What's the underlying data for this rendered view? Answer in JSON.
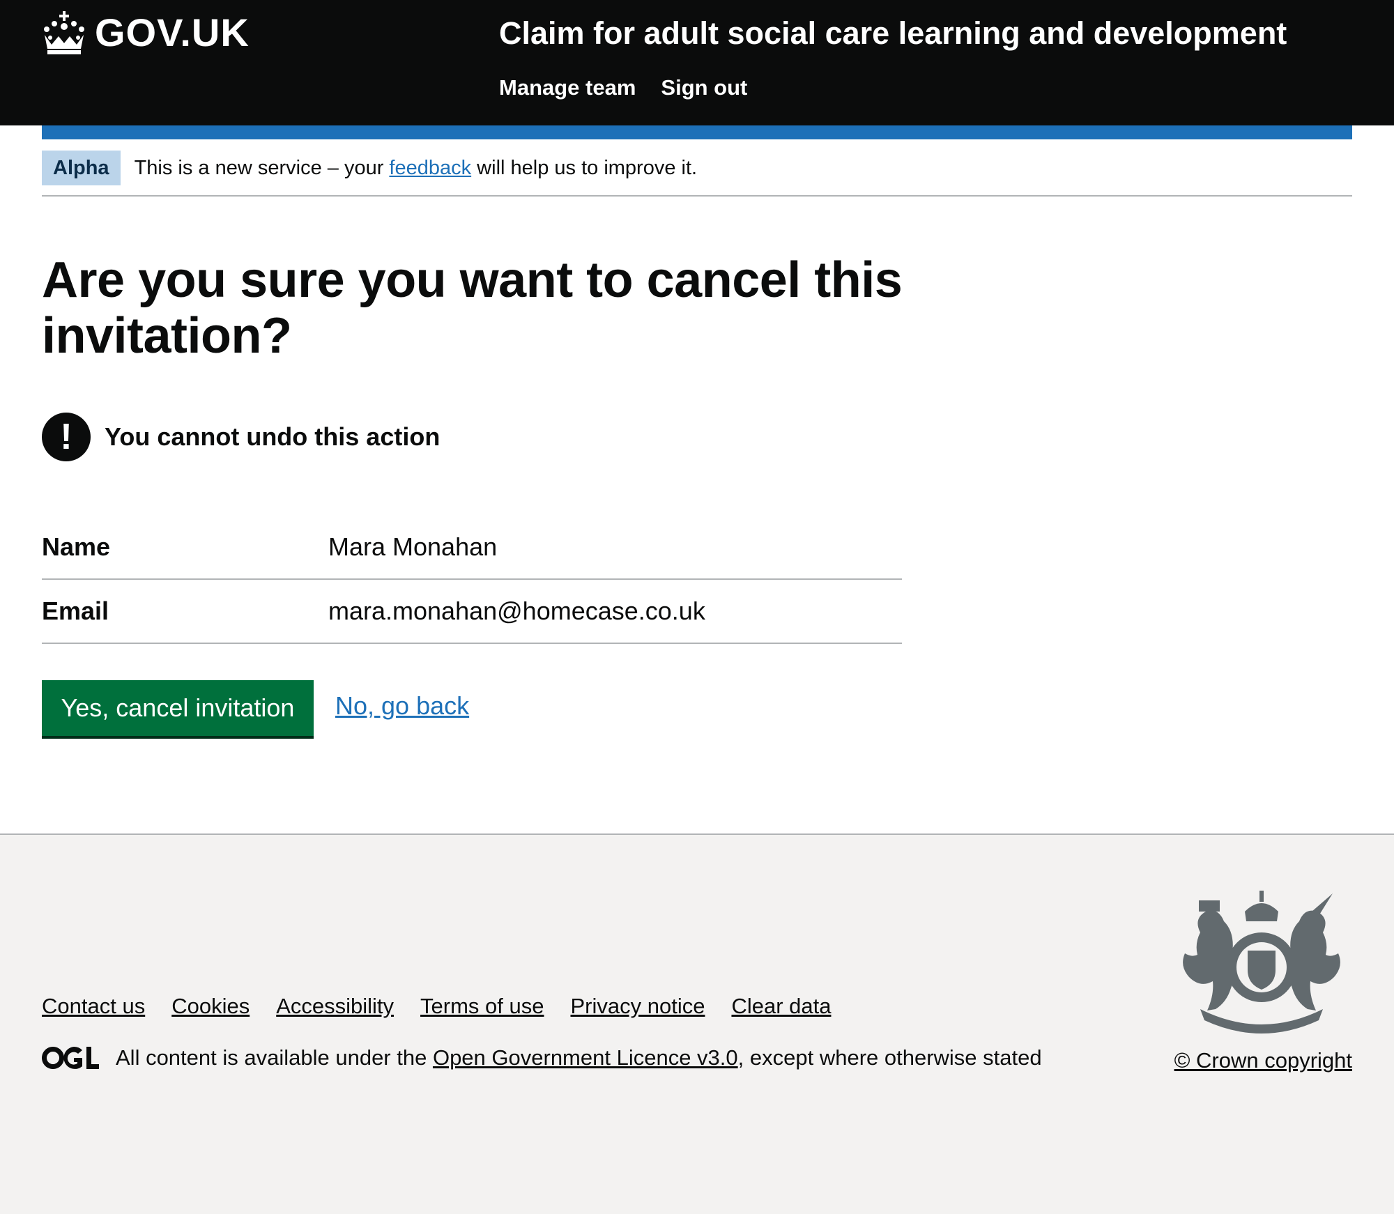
{
  "header": {
    "logo_text": "GOV.UK",
    "service_name": "Claim for adult social care learning and development",
    "nav": [
      {
        "label": "Manage team"
      },
      {
        "label": "Sign out"
      }
    ]
  },
  "phase_banner": {
    "tag": "Alpha",
    "text_before": "This is a new service – your ",
    "link": "feedback",
    "text_after": " will help us to improve it."
  },
  "page": {
    "heading": "Are you sure you want to cancel this invitation?",
    "warning_icon": "!",
    "warning_text": "You cannot undo this action",
    "summary": [
      {
        "key": "Name",
        "value": "Mara Monahan"
      },
      {
        "key": "Email",
        "value": "mara.monahan@homecase.co.uk"
      }
    ],
    "confirm_button": "Yes, cancel invitation",
    "back_link": "No, go back"
  },
  "footer": {
    "links": [
      "Contact us",
      "Cookies",
      "Accessibility",
      "Terms of use",
      "Privacy notice",
      "Clear data"
    ],
    "licence_before": "All content is available under the ",
    "licence_link": "Open Government Licence v3.0",
    "licence_after": ", except where otherwise stated",
    "copyright": "© Crown copyright"
  },
  "colors": {
    "header_bg": "#0b0c0c",
    "brand_blue": "#1d70b8",
    "button_green": "#00703c",
    "footer_bg": "#f3f2f1"
  },
  "icons": [
    "crown-icon",
    "warning-icon",
    "ogl-logo",
    "royal-coat-of-arms"
  ]
}
